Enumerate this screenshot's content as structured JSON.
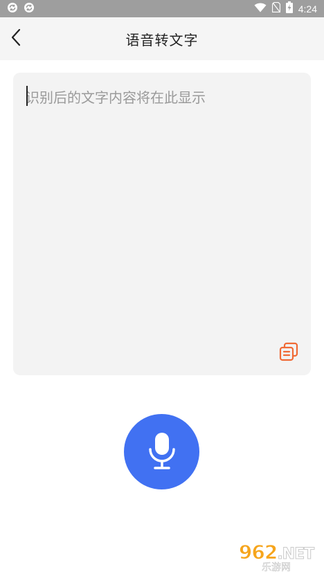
{
  "status_bar": {
    "time": "4:24",
    "icons": [
      "sync-icon",
      "sync-icon",
      "wifi-icon",
      "no-sim-icon",
      "battery-charging-icon"
    ],
    "background": "#9e9e9e"
  },
  "header": {
    "title": "语音转文字",
    "back_icon": "chevron-left-icon"
  },
  "result": {
    "placeholder": "识别后的文字内容将在此显示",
    "value": "",
    "copy_icon": "copy-icon",
    "copy_icon_color": "#f06a35"
  },
  "mic": {
    "icon": "microphone-icon",
    "color": "#4171f2"
  },
  "watermark": {
    "main": "962",
    "suffix": ".NET",
    "sub": "乐游网"
  }
}
